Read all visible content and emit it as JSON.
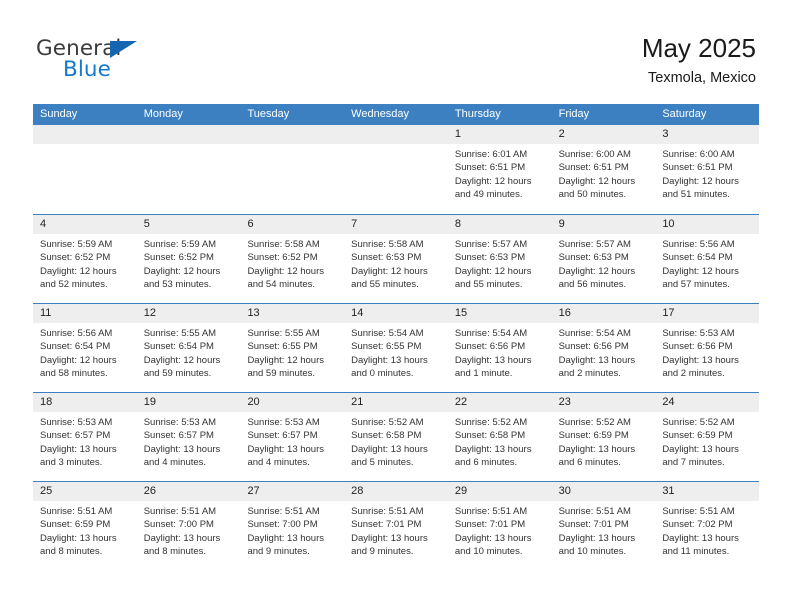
{
  "logo": {
    "word_one": "General",
    "word_two": "Blue",
    "triangle_icon": "blue-triangle-icon",
    "colors": {
      "general": "#3b3b3b",
      "blue": "#1878c8",
      "triangle": "#1565b0"
    }
  },
  "header": {
    "month_title": "May 2025",
    "location": "Texmola, Mexico"
  },
  "theme": {
    "header_blue": "#3c80c2",
    "day_band_gray": "#eeeeee",
    "text": "#333333"
  },
  "weekdays": [
    "Sunday",
    "Monday",
    "Tuesday",
    "Wednesday",
    "Thursday",
    "Friday",
    "Saturday"
  ],
  "weeks": [
    [
      {
        "empty": true
      },
      {
        "empty": true
      },
      {
        "empty": true
      },
      {
        "empty": true
      },
      {
        "day": "1",
        "sunrise": "Sunrise: 6:01 AM",
        "sunset": "Sunset: 6:51 PM",
        "daylight_line1": "Daylight: 12 hours",
        "daylight_line2": "and 49 minutes."
      },
      {
        "day": "2",
        "sunrise": "Sunrise: 6:00 AM",
        "sunset": "Sunset: 6:51 PM",
        "daylight_line1": "Daylight: 12 hours",
        "daylight_line2": "and 50 minutes."
      },
      {
        "day": "3",
        "sunrise": "Sunrise: 6:00 AM",
        "sunset": "Sunset: 6:51 PM",
        "daylight_line1": "Daylight: 12 hours",
        "daylight_line2": "and 51 minutes."
      }
    ],
    [
      {
        "day": "4",
        "sunrise": "Sunrise: 5:59 AM",
        "sunset": "Sunset: 6:52 PM",
        "daylight_line1": "Daylight: 12 hours",
        "daylight_line2": "and 52 minutes."
      },
      {
        "day": "5",
        "sunrise": "Sunrise: 5:59 AM",
        "sunset": "Sunset: 6:52 PM",
        "daylight_line1": "Daylight: 12 hours",
        "daylight_line2": "and 53 minutes."
      },
      {
        "day": "6",
        "sunrise": "Sunrise: 5:58 AM",
        "sunset": "Sunset: 6:52 PM",
        "daylight_line1": "Daylight: 12 hours",
        "daylight_line2": "and 54 minutes."
      },
      {
        "day": "7",
        "sunrise": "Sunrise: 5:58 AM",
        "sunset": "Sunset: 6:53 PM",
        "daylight_line1": "Daylight: 12 hours",
        "daylight_line2": "and 55 minutes."
      },
      {
        "day": "8",
        "sunrise": "Sunrise: 5:57 AM",
        "sunset": "Sunset: 6:53 PM",
        "daylight_line1": "Daylight: 12 hours",
        "daylight_line2": "and 55 minutes."
      },
      {
        "day": "9",
        "sunrise": "Sunrise: 5:57 AM",
        "sunset": "Sunset: 6:53 PM",
        "daylight_line1": "Daylight: 12 hours",
        "daylight_line2": "and 56 minutes."
      },
      {
        "day": "10",
        "sunrise": "Sunrise: 5:56 AM",
        "sunset": "Sunset: 6:54 PM",
        "daylight_line1": "Daylight: 12 hours",
        "daylight_line2": "and 57 minutes."
      }
    ],
    [
      {
        "day": "11",
        "sunrise": "Sunrise: 5:56 AM",
        "sunset": "Sunset: 6:54 PM",
        "daylight_line1": "Daylight: 12 hours",
        "daylight_line2": "and 58 minutes."
      },
      {
        "day": "12",
        "sunrise": "Sunrise: 5:55 AM",
        "sunset": "Sunset: 6:54 PM",
        "daylight_line1": "Daylight: 12 hours",
        "daylight_line2": "and 59 minutes."
      },
      {
        "day": "13",
        "sunrise": "Sunrise: 5:55 AM",
        "sunset": "Sunset: 6:55 PM",
        "daylight_line1": "Daylight: 12 hours",
        "daylight_line2": "and 59 minutes."
      },
      {
        "day": "14",
        "sunrise": "Sunrise: 5:54 AM",
        "sunset": "Sunset: 6:55 PM",
        "daylight_line1": "Daylight: 13 hours",
        "daylight_line2": "and 0 minutes."
      },
      {
        "day": "15",
        "sunrise": "Sunrise: 5:54 AM",
        "sunset": "Sunset: 6:56 PM",
        "daylight_line1": "Daylight: 13 hours",
        "daylight_line2": "and 1 minute."
      },
      {
        "day": "16",
        "sunrise": "Sunrise: 5:54 AM",
        "sunset": "Sunset: 6:56 PM",
        "daylight_line1": "Daylight: 13 hours",
        "daylight_line2": "and 2 minutes."
      },
      {
        "day": "17",
        "sunrise": "Sunrise: 5:53 AM",
        "sunset": "Sunset: 6:56 PM",
        "daylight_line1": "Daylight: 13 hours",
        "daylight_line2": "and 2 minutes."
      }
    ],
    [
      {
        "day": "18",
        "sunrise": "Sunrise: 5:53 AM",
        "sunset": "Sunset: 6:57 PM",
        "daylight_line1": "Daylight: 13 hours",
        "daylight_line2": "and 3 minutes."
      },
      {
        "day": "19",
        "sunrise": "Sunrise: 5:53 AM",
        "sunset": "Sunset: 6:57 PM",
        "daylight_line1": "Daylight: 13 hours",
        "daylight_line2": "and 4 minutes."
      },
      {
        "day": "20",
        "sunrise": "Sunrise: 5:53 AM",
        "sunset": "Sunset: 6:57 PM",
        "daylight_line1": "Daylight: 13 hours",
        "daylight_line2": "and 4 minutes."
      },
      {
        "day": "21",
        "sunrise": "Sunrise: 5:52 AM",
        "sunset": "Sunset: 6:58 PM",
        "daylight_line1": "Daylight: 13 hours",
        "daylight_line2": "and 5 minutes."
      },
      {
        "day": "22",
        "sunrise": "Sunrise: 5:52 AM",
        "sunset": "Sunset: 6:58 PM",
        "daylight_line1": "Daylight: 13 hours",
        "daylight_line2": "and 6 minutes."
      },
      {
        "day": "23",
        "sunrise": "Sunrise: 5:52 AM",
        "sunset": "Sunset: 6:59 PM",
        "daylight_line1": "Daylight: 13 hours",
        "daylight_line2": "and 6 minutes."
      },
      {
        "day": "24",
        "sunrise": "Sunrise: 5:52 AM",
        "sunset": "Sunset: 6:59 PM",
        "daylight_line1": "Daylight: 13 hours",
        "daylight_line2": "and 7 minutes."
      }
    ],
    [
      {
        "day": "25",
        "sunrise": "Sunrise: 5:51 AM",
        "sunset": "Sunset: 6:59 PM",
        "daylight_line1": "Daylight: 13 hours",
        "daylight_line2": "and 8 minutes."
      },
      {
        "day": "26",
        "sunrise": "Sunrise: 5:51 AM",
        "sunset": "Sunset: 7:00 PM",
        "daylight_line1": "Daylight: 13 hours",
        "daylight_line2": "and 8 minutes."
      },
      {
        "day": "27",
        "sunrise": "Sunrise: 5:51 AM",
        "sunset": "Sunset: 7:00 PM",
        "daylight_line1": "Daylight: 13 hours",
        "daylight_line2": "and 9 minutes."
      },
      {
        "day": "28",
        "sunrise": "Sunrise: 5:51 AM",
        "sunset": "Sunset: 7:01 PM",
        "daylight_line1": "Daylight: 13 hours",
        "daylight_line2": "and 9 minutes."
      },
      {
        "day": "29",
        "sunrise": "Sunrise: 5:51 AM",
        "sunset": "Sunset: 7:01 PM",
        "daylight_line1": "Daylight: 13 hours",
        "daylight_line2": "and 10 minutes."
      },
      {
        "day": "30",
        "sunrise": "Sunrise: 5:51 AM",
        "sunset": "Sunset: 7:01 PM",
        "daylight_line1": "Daylight: 13 hours",
        "daylight_line2": "and 10 minutes."
      },
      {
        "day": "31",
        "sunrise": "Sunrise: 5:51 AM",
        "sunset": "Sunset: 7:02 PM",
        "daylight_line1": "Daylight: 13 hours",
        "daylight_line2": "and 11 minutes."
      }
    ]
  ]
}
